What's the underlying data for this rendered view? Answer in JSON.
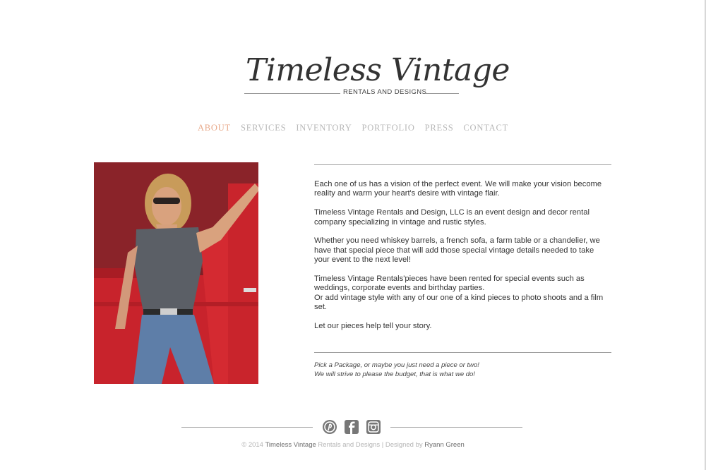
{
  "logo": {
    "title": "Timeless Vintage",
    "subtitle": "RENTALS AND DESIGNS"
  },
  "nav": {
    "items": [
      "ABOUT",
      "SERVICES",
      "INVENTORY",
      "PORTFOLIO",
      "PRESS",
      "CONTACT"
    ],
    "active": "ABOUT",
    "active_color": "#e8a98a",
    "inactive_color": "#b8b8b8"
  },
  "photo": {
    "icon": "woman-leaning-on-red-truck-photo"
  },
  "content": {
    "paragraphs": [
      "Each one of us has a vision of the perfect event. We will make your vision become reality and warm your heart's desire with vintage flair.",
      "Timeless Vintage Rentals and Design, LLC is an event design and decor rental company specializing in vintage and rustic styles.",
      "Whether you need whiskey barrels, a french sofa, a farm table or a chandelier, we have that special piece that will add those special vintage details needed to take your event to the next level!",
      "Timeless Vintage Rentals'pieces have been rented for special events such as weddings, corporate events and birthday parties.",
      "Or add vintage style with any of our one of a kind pieces to photo shoots and a film set.",
      "Let our pieces help tell your story."
    ],
    "tagline_1": "Pick a Package, or maybe you just need a piece or two!",
    "tagline_2": "We will strive to please the budget, that is what we do!"
  },
  "footer": {
    "social": [
      "pinterest-icon",
      "facebook-icon",
      "instagram-icon"
    ],
    "copyright_prefix": "© 2014 ",
    "brand": "Timeless Vintage",
    "brand_suffix": " Rentals and Designs | Designed by ",
    "designer": "Ryann Green"
  }
}
